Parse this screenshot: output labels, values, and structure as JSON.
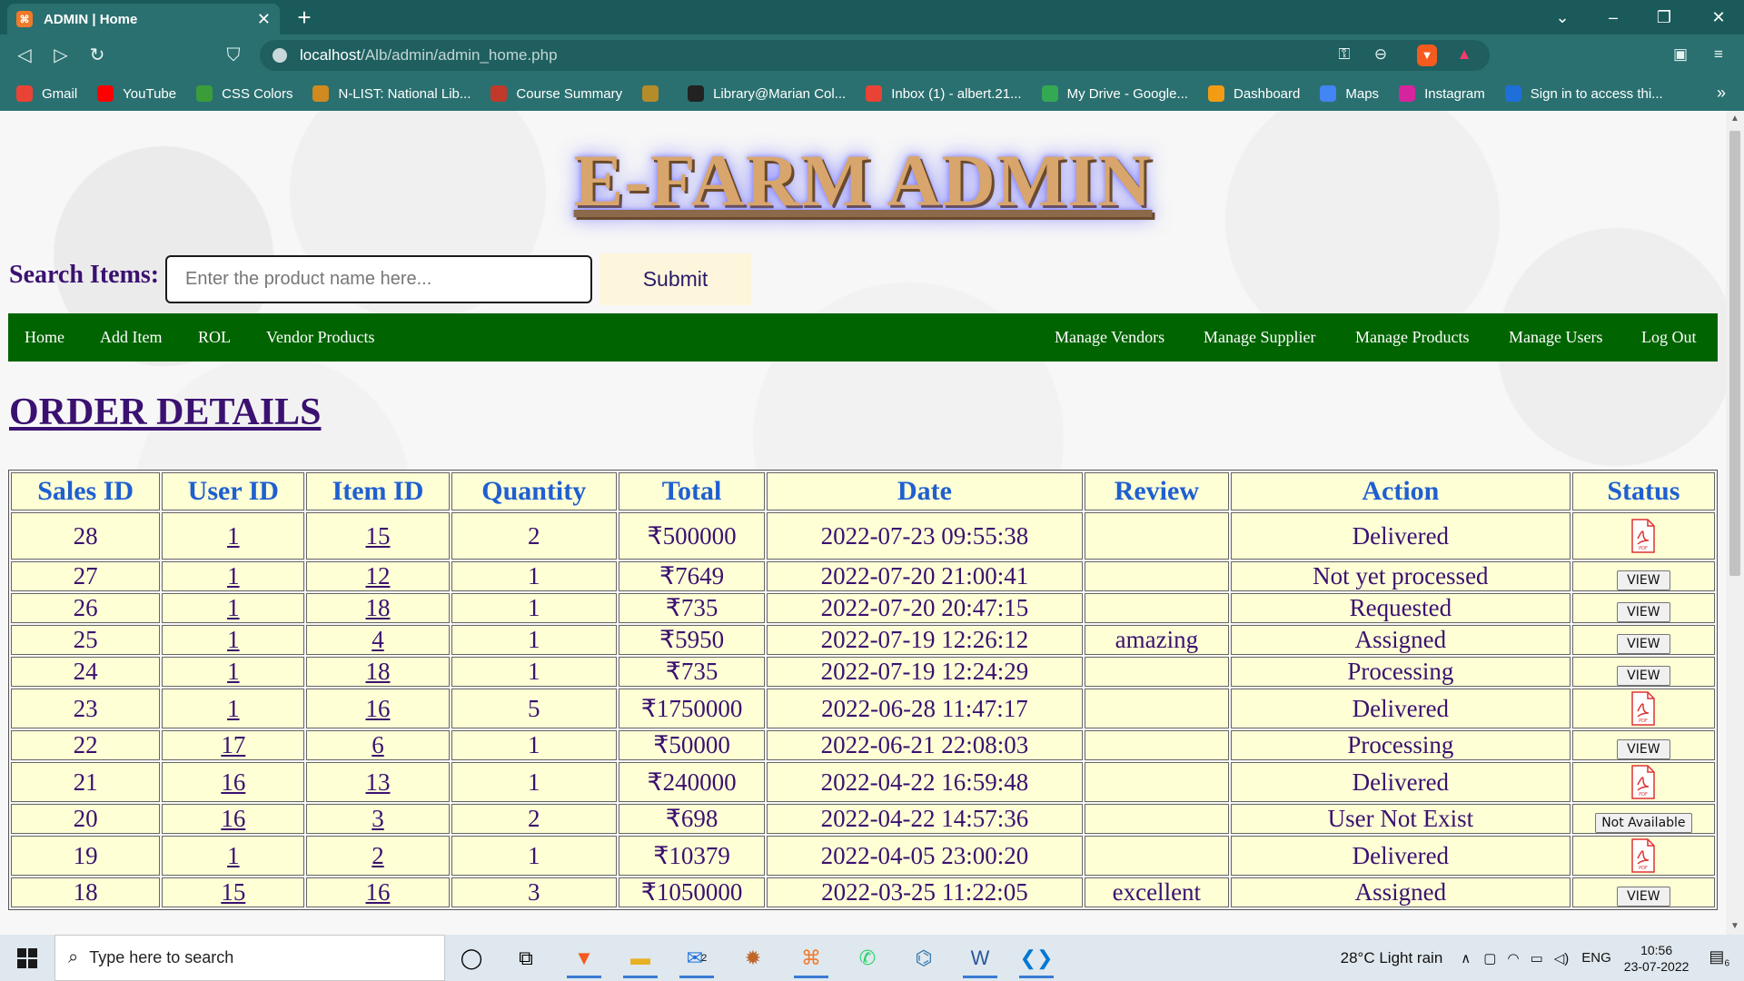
{
  "browser": {
    "tab_title": "ADMIN | Home",
    "tab_close": "✕",
    "new_tab": "+",
    "url_host": "localhost",
    "url_path": "/Alb/admin/admin_home.php",
    "bookmarks": [
      {
        "label": "Gmail",
        "icon": "gmail-icon",
        "color": "#ea4335"
      },
      {
        "label": "YouTube",
        "icon": "youtube-icon",
        "color": "#ff0000"
      },
      {
        "label": "CSS Colors",
        "icon": "css-colors-icon",
        "color": "#3a9d3a"
      },
      {
        "label": "N-LIST: National Lib...",
        "icon": "nlist-icon",
        "color": "#d08a20"
      },
      {
        "label": "Course Summary",
        "icon": "course-summary-icon",
        "color": "#c0392b"
      },
      {
        "label": "",
        "icon": "university-icon",
        "color": "#b58c2a"
      },
      {
        "label": "Library@Marian Col...",
        "icon": "library-icon",
        "color": "#222222"
      },
      {
        "label": "Inbox (1) - albert.21...",
        "icon": "gmail-icon",
        "color": "#ea4335"
      },
      {
        "label": "My Drive - Google...",
        "icon": "google-drive-icon",
        "color": "#34a853"
      },
      {
        "label": "Dashboard",
        "icon": "dashboard-icon",
        "color": "#f39c12"
      },
      {
        "label": "Maps",
        "icon": "maps-icon",
        "color": "#4285f4"
      },
      {
        "label": "Instagram",
        "icon": "instagram-icon",
        "color": "#d6249f"
      },
      {
        "label": "Sign in to access thi...",
        "icon": "sign-in-icon",
        "color": "#1e6fd9"
      }
    ],
    "bookmarks_more": "»"
  },
  "site": {
    "title": "E-FARM ADMIN",
    "search_label": "Search Items:",
    "search_placeholder": "Enter the product name here...",
    "submit_label": "Submit",
    "nav_left": [
      "Home",
      "Add Item",
      "ROL",
      "Vendor Products"
    ],
    "nav_right": [
      "Manage Vendors",
      "Manage Supplier",
      "Manage Products",
      "Manage Users",
      "Log Out"
    ],
    "section_heading": "ORDER DETAILS"
  },
  "orders": {
    "columns": [
      "Sales ID",
      "User ID",
      "Item ID",
      "Quantity",
      "Total",
      "Date",
      "Review",
      "Action",
      "Status"
    ],
    "rows": [
      {
        "sales_id": "28",
        "user_id": "1",
        "item_id": "15",
        "quantity": "2",
        "total": "₹500000",
        "date": "2022-07-23 09:55:38",
        "review": "",
        "action": "Delivered",
        "status": "pdf"
      },
      {
        "sales_id": "27",
        "user_id": "1",
        "item_id": "12",
        "quantity": "1",
        "total": "₹7649",
        "date": "2022-07-20 21:00:41",
        "review": "",
        "action": "Not yet processed",
        "status": "VIEW"
      },
      {
        "sales_id": "26",
        "user_id": "1",
        "item_id": "18",
        "quantity": "1",
        "total": "₹735",
        "date": "2022-07-20 20:47:15",
        "review": "",
        "action": "Requested",
        "status": "VIEW"
      },
      {
        "sales_id": "25",
        "user_id": "1",
        "item_id": "4",
        "quantity": "1",
        "total": "₹5950",
        "date": "2022-07-19 12:26:12",
        "review": "amazing",
        "action": "Assigned",
        "status": "VIEW"
      },
      {
        "sales_id": "24",
        "user_id": "1",
        "item_id": "18",
        "quantity": "1",
        "total": "₹735",
        "date": "2022-07-19 12:24:29",
        "review": "",
        "action": "Processing",
        "status": "VIEW"
      },
      {
        "sales_id": "23",
        "user_id": "1",
        "item_id": "16",
        "quantity": "5",
        "total": "₹1750000",
        "date": "2022-06-28 11:47:17",
        "review": "",
        "action": "Delivered",
        "status": "pdf"
      },
      {
        "sales_id": "22",
        "user_id": "17",
        "item_id": "6",
        "quantity": "1",
        "total": "₹50000",
        "date": "2022-06-21 22:08:03",
        "review": "",
        "action": "Processing",
        "status": "VIEW"
      },
      {
        "sales_id": "21",
        "user_id": "16",
        "item_id": "13",
        "quantity": "1",
        "total": "₹240000",
        "date": "2022-04-22 16:59:48",
        "review": "",
        "action": "Delivered",
        "status": "pdf"
      },
      {
        "sales_id": "20",
        "user_id": "16",
        "item_id": "3",
        "quantity": "2",
        "total": "₹698",
        "date": "2022-04-22 14:57:36",
        "review": "",
        "action": "User Not Exist",
        "status": "Not Available"
      },
      {
        "sales_id": "19",
        "user_id": "1",
        "item_id": "2",
        "quantity": "1",
        "total": "₹10379",
        "date": "2022-04-05 23:00:20",
        "review": "",
        "action": "Delivered",
        "status": "pdf"
      },
      {
        "sales_id": "18",
        "user_id": "15",
        "item_id": "16",
        "quantity": "3",
        "total": "₹1050000",
        "date": "2022-03-25 11:22:05",
        "review": "excellent",
        "action": "Assigned",
        "status": "VIEW"
      }
    ]
  },
  "taskbar": {
    "search_placeholder": "Type here to search",
    "apps": [
      "cortana-icon",
      "task-view-icon",
      "brave-icon",
      "file-explorer-icon",
      "mail-icon",
      "app-icon",
      "xampp-icon",
      "whatsapp-icon",
      "python-icon",
      "word-icon",
      "vscode-icon"
    ],
    "mail_badge": "2",
    "weather": "28°C  Light rain",
    "language": "ENG",
    "time": "10:56",
    "date": "23-07-2022",
    "notification_count": "6"
  },
  "colors": {
    "chrome": "#2b7070",
    "navbar": "#006400",
    "heading": "#3a1170",
    "table_header": "#1f5fd0",
    "table_cell": "#ffffd6"
  }
}
